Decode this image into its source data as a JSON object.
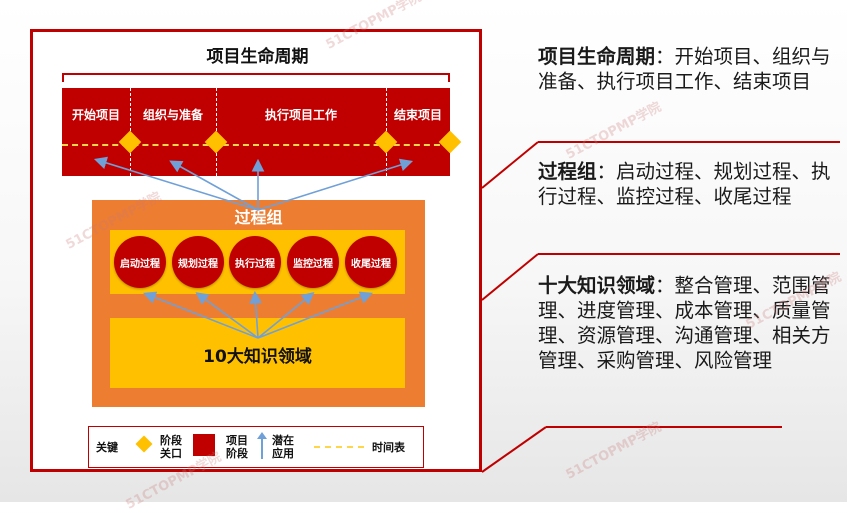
{
  "diagram": {
    "title": "项目生命周期",
    "phases": [
      "开始项目",
      "组织与准备",
      "执行项目工作",
      "结束项目"
    ],
    "process_group_title": "过程组",
    "processes": [
      "启动过程",
      "规划过程",
      "执行过程",
      "监控过程",
      "收尾过程"
    ],
    "knowledge_areas": "10大知识领域"
  },
  "legend": {
    "key": "关键",
    "gate_label": "阶段\n关口",
    "phase_label": "项目\n阶段",
    "usage_label": "潜在\n应用",
    "timeline_label": "时间表"
  },
  "descriptions": [
    {
      "term": "项目生命周期",
      "text": "：开始项目、组织与准备、执行项目工作、结束项目"
    },
    {
      "term": "过程组",
      "text": "：启动过程、规划过程、执行过程、监控过程、收尾过程"
    },
    {
      "term": "十大知识领域",
      "text": "：整合管理、范围管理、进度管理、成本管理、质量管理、资源管理、沟通管理、相关方管理、采购管理、风险管理"
    }
  ],
  "watermark": "51CTOPMP学院",
  "colors": {
    "red": "#c00000",
    "orange": "#ed7d31",
    "gold": "#ffc000"
  }
}
